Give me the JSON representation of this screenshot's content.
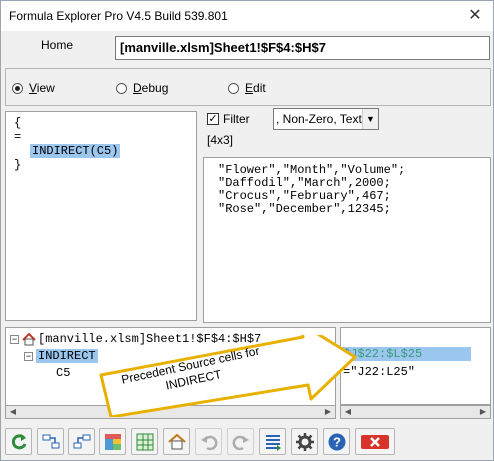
{
  "window": {
    "title": "Formula Explorer Pro V4.5 Build 539.801",
    "close_glyph": "✕"
  },
  "home": {
    "label": "Home",
    "address": "[manville.xlsm]Sheet1!$F$4:$H$7"
  },
  "modes": [
    {
      "label": "View",
      "selected": true
    },
    {
      "label": "Debug",
      "selected": false
    },
    {
      "label": "Edit",
      "selected": false
    }
  ],
  "formula": {
    "lines": [
      "{",
      "=",
      "INDIRECT(C5)",
      "}"
    ]
  },
  "filter": {
    "label": "Filter",
    "checked": true,
    "select_value": ", Non-Zero, Text",
    "dims": "[4x3]"
  },
  "values": {
    "lines": [
      "\"Flower\",\"Month\",\"Volume\";",
      "\"Daffodil\",\"March\",2000;",
      "\"Crocus\",\"February\",467;",
      "\"Rose\",\"December\",12345;"
    ]
  },
  "tree": {
    "root": "[manville.xlsm]Sheet1!$F$4:$H$7",
    "child": "INDIRECT",
    "grandchild": "C5"
  },
  "source": {
    "lines": [
      "$J$22:$L$25",
      "=\"J22:L25\""
    ]
  },
  "callout": {
    "text": "Precedent Source cells for INDIRECT"
  },
  "toolbar": {
    "buttons": [
      "refresh-icon",
      "trace-precedents-icon",
      "trace-dependents-icon",
      "color-grid-icon",
      "sheet-map-icon",
      "home-icon",
      "undo-icon",
      "redo-icon",
      "list-icon",
      "settings-icon",
      "help-icon",
      "close-icon"
    ]
  },
  "colors": {
    "selection": "#9bc6ee",
    "source_text": "#3a9a7a",
    "callout_fill": "#ffffff",
    "callout_border": "#e8b000"
  }
}
